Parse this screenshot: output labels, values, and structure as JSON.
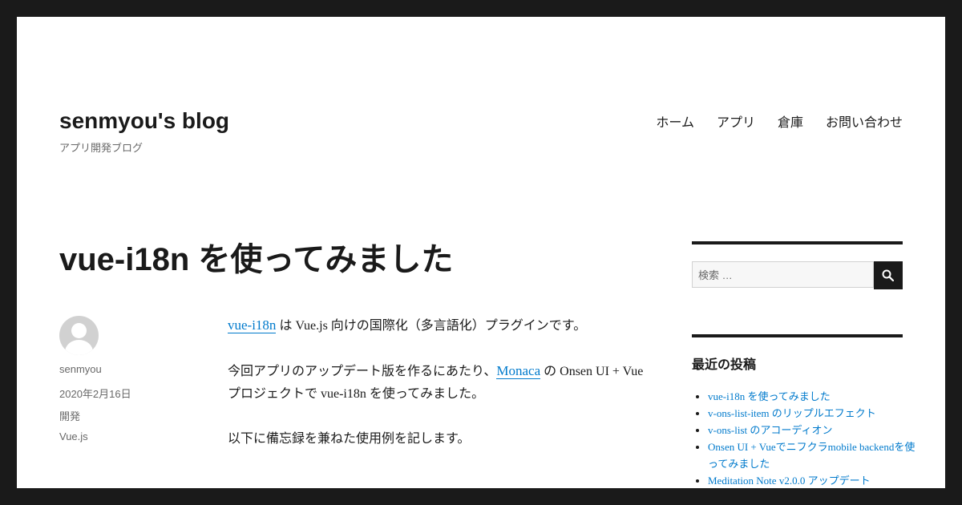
{
  "header": {
    "site_title": "senmyou's blog",
    "site_description": "アプリ開発ブログ",
    "nav": [
      "ホーム",
      "アプリ",
      "倉庫",
      "お問い合わせ"
    ]
  },
  "post": {
    "title": "vue-i18n を使ってみました",
    "author": "senmyou",
    "date": "2020年2月16日",
    "category": "開発",
    "tag": "Vue.js",
    "p1_link": "vue-i18n",
    "p1_text": " は Vue.js 向けの国際化（多言語化）プラグインです。",
    "p2_prefix": "今回アプリのアップデート版を作るにあたり、",
    "p2_link": "Monaca",
    "p2_suffix": " の Onsen UI + Vue プロジェクトで vue-i18n を使ってみました。",
    "p3_text": "以下に備忘録を兼ねた使用例を記します。"
  },
  "sidebar": {
    "search_placeholder": "検索 …",
    "search_icon": "search-icon",
    "recent_title": "最近の投稿",
    "recent_posts": [
      "vue-i18n を使ってみました",
      "v-ons-list-item のリップルエフェクト",
      "v-ons-list のアコーディオン",
      "Onsen UI + Vueでニフクラmobile backendを使ってみました",
      "Meditation Note v2.0.0 アップデート"
    ]
  },
  "colors": {
    "frame": "#1a1a1a",
    "link": "#007acc",
    "muted": "#686868"
  }
}
